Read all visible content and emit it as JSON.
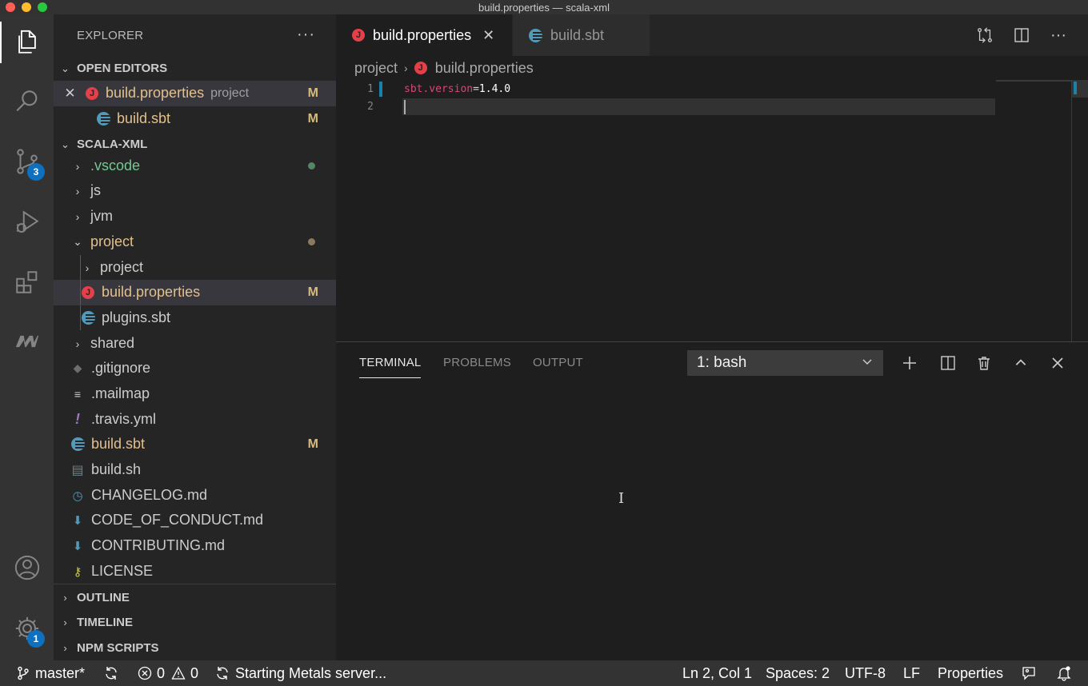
{
  "window": {
    "title": "build.properties — scala-xml",
    "traffic_lights": [
      "#ff5f57",
      "#febc2e",
      "#28c840"
    ]
  },
  "activity_bar": {
    "items": [
      {
        "name": "explorer-icon",
        "active": true
      },
      {
        "name": "search-icon"
      },
      {
        "name": "source-control-icon",
        "badge": "3"
      },
      {
        "name": "run-debug-icon"
      },
      {
        "name": "extensions-icon"
      },
      {
        "name": "metals-icon"
      }
    ],
    "bottom": [
      {
        "name": "account-icon"
      },
      {
        "name": "settings-gear-icon",
        "badge": "1"
      }
    ]
  },
  "sidebar": {
    "title": "EXPLORER",
    "open_editors": {
      "title": "OPEN EDITORS",
      "items": [
        {
          "name": "build.properties",
          "desc": "project",
          "status": "M"
        },
        {
          "name": "build.sbt",
          "status": "M"
        }
      ]
    },
    "workspace": {
      "title": "SCALA-XML",
      "items": [
        {
          "name": ".vscode",
          "type": "folder",
          "expanded": false
        },
        {
          "name": "js",
          "type": "folder",
          "expanded": false
        },
        {
          "name": "jvm",
          "type": "folder",
          "expanded": false
        },
        {
          "name": "project",
          "type": "folder",
          "expanded": true
        },
        {
          "name": "project",
          "type": "folder",
          "expanded": false
        },
        {
          "name": "build.properties",
          "type": "file",
          "status": "M"
        },
        {
          "name": "plugins.sbt",
          "type": "file"
        },
        {
          "name": "shared",
          "type": "folder",
          "expanded": false
        },
        {
          "name": ".gitignore",
          "type": "file"
        },
        {
          "name": ".mailmap",
          "type": "file"
        },
        {
          "name": ".travis.yml",
          "type": "file"
        },
        {
          "name": "build.sbt",
          "type": "file",
          "status": "M"
        },
        {
          "name": "build.sh",
          "type": "file"
        },
        {
          "name": "CHANGELOG.md",
          "type": "file"
        },
        {
          "name": "CODE_OF_CONDUCT.md",
          "type": "file"
        },
        {
          "name": "CONTRIBUTING.md",
          "type": "file"
        },
        {
          "name": "LICENSE",
          "type": "file"
        }
      ]
    },
    "collapsed_sections": [
      "OUTLINE",
      "TIMELINE",
      "NPM SCRIPTS"
    ]
  },
  "editor": {
    "tabs": [
      {
        "label": "build.properties",
        "active": true
      },
      {
        "label": "build.sbt",
        "active": false
      }
    ],
    "breadcrumb": [
      "project",
      "build.properties"
    ],
    "lines": [
      {
        "number": "1",
        "key": "sbt.version",
        "eq": "=",
        "value": "1.4.0"
      },
      {
        "number": "2",
        "key": "",
        "eq": "",
        "value": ""
      }
    ]
  },
  "panel": {
    "tabs": [
      "TERMINAL",
      "PROBLEMS",
      "OUTPUT"
    ],
    "active_tab": "TERMINAL",
    "terminal_select": "1: bash"
  },
  "status_bar": {
    "branch": "master*",
    "errors": "0",
    "warnings": "0",
    "metals_status": "Starting Metals server...",
    "position": "Ln 2, Col 1",
    "indent": "Spaces: 2",
    "encoding": "UTF-8",
    "eol": "LF",
    "language": "Properties"
  },
  "colors": {
    "accent": "#0e70c0",
    "modified": "#d7ba7d",
    "untracked_green": "#73c991"
  }
}
